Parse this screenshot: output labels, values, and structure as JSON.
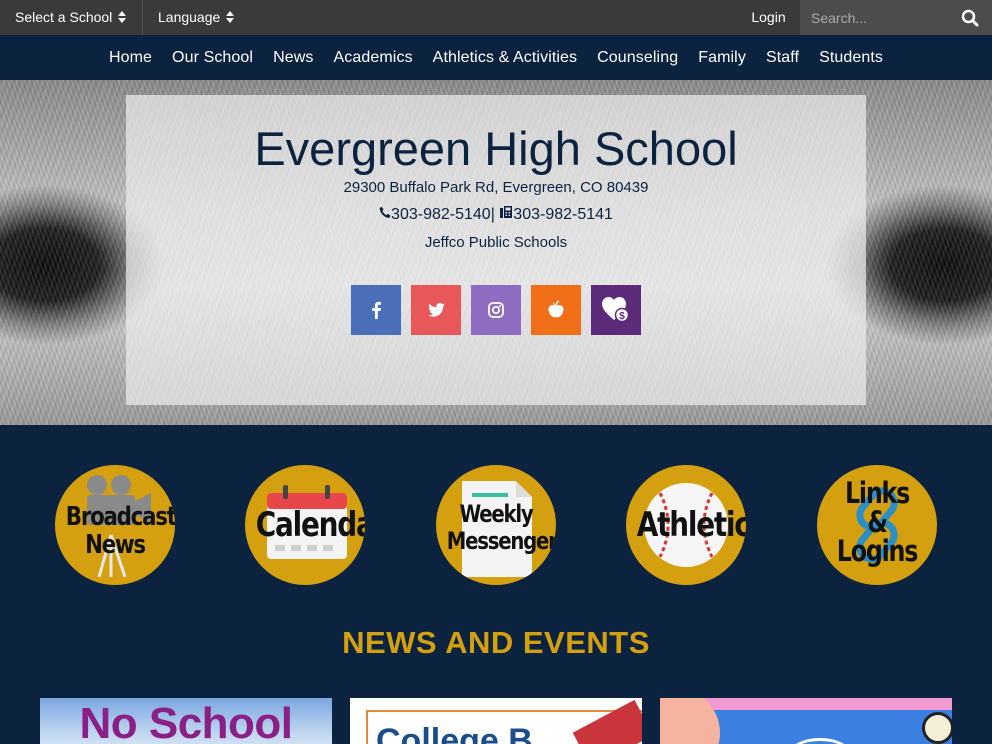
{
  "topbar": {
    "select_school": "Select a School",
    "language": "Language",
    "login": "Login",
    "search_placeholder": "Search..."
  },
  "nav": {
    "items": [
      "Home",
      "Our School",
      "News",
      "Academics",
      "Athletics & Activities",
      "Counseling",
      "Family",
      "Staff",
      "Students"
    ]
  },
  "hero": {
    "school_name": "Evergreen High School",
    "address": "29300 Buffalo Park Rd, Evergreen, CO 80439",
    "phone": "303-982-5140",
    "separator": "|",
    "fax": "303-982-5141",
    "district": "Jeffco Public Schools",
    "socials": [
      {
        "name": "facebook",
        "color": "#4a6fb8"
      },
      {
        "name": "twitter",
        "color": "#e8585a"
      },
      {
        "name": "instagram",
        "color": "#8e6cc2"
      },
      {
        "name": "peachjar",
        "color": "#f26f1a"
      },
      {
        "name": "donate",
        "color": "#5b2b7a"
      }
    ]
  },
  "quick_links": [
    {
      "label_line1": "Broadcast",
      "label_line2": "News",
      "icon": "movie-camera-icon"
    },
    {
      "label_line1": "Calendar",
      "label_line2": "",
      "icon": "calendar-icon"
    },
    {
      "label_line1": "Weekly",
      "label_line2": "Messenger",
      "icon": "document-icon"
    },
    {
      "label_line1": "Athletics",
      "label_line2": "",
      "icon": "baseball-icon"
    },
    {
      "label_line1": "Links",
      "label_line2": "&",
      "label_line3": "Logins",
      "icon": "chain-link-icon"
    }
  ],
  "news": {
    "title": "NEWS AND EVENTS",
    "cards": [
      {
        "visible_text": "No School"
      },
      {
        "visible_text": "College B"
      },
      {
        "visible_text": ""
      }
    ]
  },
  "colors": {
    "navy": "#0c2340",
    "gold": "#d4a010",
    "topbar": "#3a3a3a"
  }
}
